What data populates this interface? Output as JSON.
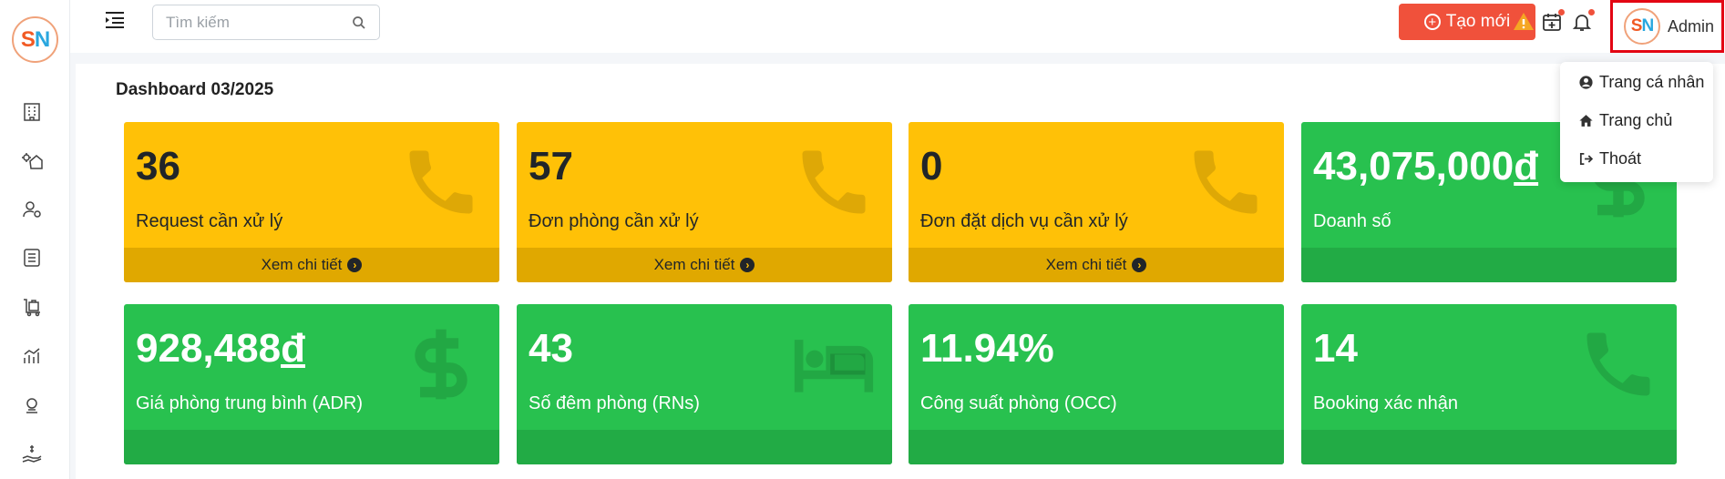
{
  "brand": {
    "logo_s": "S",
    "logo_n": "N"
  },
  "header": {
    "search_placeholder": "Tìm kiếm",
    "new_button": "Tạo mới",
    "user_name": "Admin"
  },
  "dashboard": {
    "title": "Dashboard 03/2025",
    "cards": [
      {
        "value": "36",
        "label": "Request cần xử lý",
        "footer": "Xem chi tiết",
        "color": "#ffc107",
        "icon": "phone-icon"
      },
      {
        "value": "57",
        "label": "Đơn phòng cần xử lý",
        "footer": "Xem chi tiết",
        "color": "#ffc107",
        "icon": "phone-icon"
      },
      {
        "value": "0",
        "label": "Đơn đặt dịch vụ cần xử lý",
        "footer": "Xem chi tiết",
        "color": "#ffc107",
        "icon": "phone-icon"
      },
      {
        "value": "43,075,000",
        "currency": "đ",
        "label": "Doanh số",
        "color": "#28c14f",
        "icon": "dollar-icon"
      },
      {
        "value": "928,488",
        "currency": "đ",
        "label": "Giá phòng trung bình (ADR)",
        "color": "#28c14f",
        "icon": "dollar-icon"
      },
      {
        "value": "43",
        "label": "Số đêm phòng (RNs)",
        "color": "#28c14f",
        "icon": "bed-icon"
      },
      {
        "value": "11.94%",
        "label": "Công suất phòng (OCC)",
        "color": "#28c14f",
        "icon": "none"
      },
      {
        "value": "14",
        "label": "Booking xác nhận",
        "color": "#28c14f",
        "icon": "phone-icon"
      }
    ]
  },
  "user_menu": {
    "items": [
      {
        "label": "Trang cá nhân",
        "icon": "user-circle-icon"
      },
      {
        "label": "Trang chủ",
        "icon": "home-icon"
      },
      {
        "label": "Thoát",
        "icon": "sign-out-icon"
      }
    ]
  },
  "colors": {
    "accent": "#f0513b",
    "warning": "#ffc107",
    "success": "#28c14f",
    "highlight_border": "#e30613"
  }
}
